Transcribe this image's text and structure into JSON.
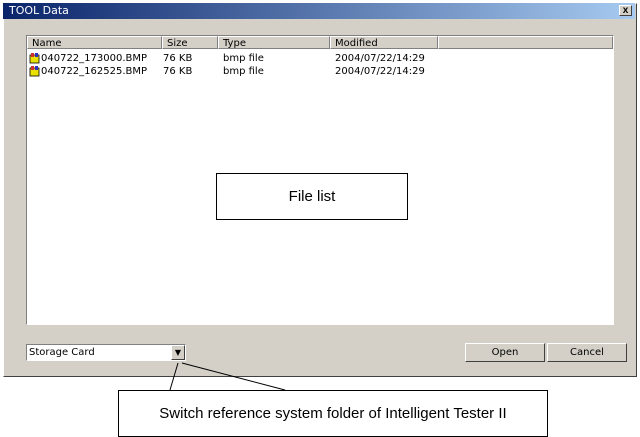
{
  "window": {
    "title": "TOOL Data",
    "close_label": "x"
  },
  "list": {
    "columns": [
      "Name",
      "Size",
      "Type",
      "Modified"
    ],
    "rows": [
      {
        "name": "040722_173000.BMP",
        "size": "76 KB",
        "type": "bmp file",
        "modified": "2004/07/22/14:29"
      },
      {
        "name": "040722_162525.BMP",
        "size": "76 KB",
        "type": "bmp file",
        "modified": "2004/07/22/14:29"
      }
    ]
  },
  "combo": {
    "value": "Storage Card"
  },
  "buttons": {
    "open": "Open",
    "cancel": "Cancel"
  },
  "annotations": {
    "file_list": "File list",
    "switch_folder": "Switch reference system folder of Intelligent Tester II"
  }
}
